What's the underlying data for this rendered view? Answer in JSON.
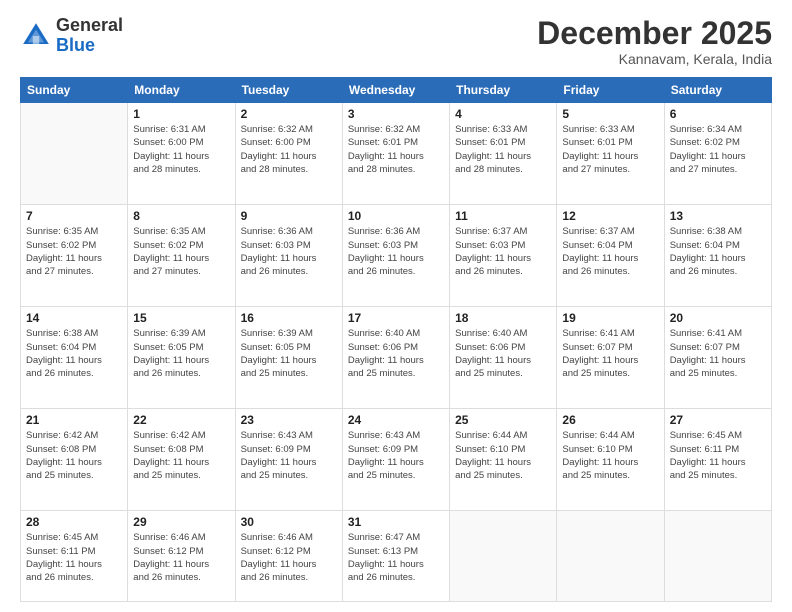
{
  "logo": {
    "general": "General",
    "blue": "Blue"
  },
  "title": "December 2025",
  "location": "Kannavam, Kerala, India",
  "days_of_week": [
    "Sunday",
    "Monday",
    "Tuesday",
    "Wednesday",
    "Thursday",
    "Friday",
    "Saturday"
  ],
  "weeks": [
    [
      {
        "day": "",
        "info": ""
      },
      {
        "day": "1",
        "info": "Sunrise: 6:31 AM\nSunset: 6:00 PM\nDaylight: 11 hours\nand 28 minutes."
      },
      {
        "day": "2",
        "info": "Sunrise: 6:32 AM\nSunset: 6:00 PM\nDaylight: 11 hours\nand 28 minutes."
      },
      {
        "day": "3",
        "info": "Sunrise: 6:32 AM\nSunset: 6:01 PM\nDaylight: 11 hours\nand 28 minutes."
      },
      {
        "day": "4",
        "info": "Sunrise: 6:33 AM\nSunset: 6:01 PM\nDaylight: 11 hours\nand 28 minutes."
      },
      {
        "day": "5",
        "info": "Sunrise: 6:33 AM\nSunset: 6:01 PM\nDaylight: 11 hours\nand 27 minutes."
      },
      {
        "day": "6",
        "info": "Sunrise: 6:34 AM\nSunset: 6:02 PM\nDaylight: 11 hours\nand 27 minutes."
      }
    ],
    [
      {
        "day": "7",
        "info": "Sunrise: 6:35 AM\nSunset: 6:02 PM\nDaylight: 11 hours\nand 27 minutes."
      },
      {
        "day": "8",
        "info": "Sunrise: 6:35 AM\nSunset: 6:02 PM\nDaylight: 11 hours\nand 27 minutes."
      },
      {
        "day": "9",
        "info": "Sunrise: 6:36 AM\nSunset: 6:03 PM\nDaylight: 11 hours\nand 26 minutes."
      },
      {
        "day": "10",
        "info": "Sunrise: 6:36 AM\nSunset: 6:03 PM\nDaylight: 11 hours\nand 26 minutes."
      },
      {
        "day": "11",
        "info": "Sunrise: 6:37 AM\nSunset: 6:03 PM\nDaylight: 11 hours\nand 26 minutes."
      },
      {
        "day": "12",
        "info": "Sunrise: 6:37 AM\nSunset: 6:04 PM\nDaylight: 11 hours\nand 26 minutes."
      },
      {
        "day": "13",
        "info": "Sunrise: 6:38 AM\nSunset: 6:04 PM\nDaylight: 11 hours\nand 26 minutes."
      }
    ],
    [
      {
        "day": "14",
        "info": "Sunrise: 6:38 AM\nSunset: 6:04 PM\nDaylight: 11 hours\nand 26 minutes."
      },
      {
        "day": "15",
        "info": "Sunrise: 6:39 AM\nSunset: 6:05 PM\nDaylight: 11 hours\nand 26 minutes."
      },
      {
        "day": "16",
        "info": "Sunrise: 6:39 AM\nSunset: 6:05 PM\nDaylight: 11 hours\nand 25 minutes."
      },
      {
        "day": "17",
        "info": "Sunrise: 6:40 AM\nSunset: 6:06 PM\nDaylight: 11 hours\nand 25 minutes."
      },
      {
        "day": "18",
        "info": "Sunrise: 6:40 AM\nSunset: 6:06 PM\nDaylight: 11 hours\nand 25 minutes."
      },
      {
        "day": "19",
        "info": "Sunrise: 6:41 AM\nSunset: 6:07 PM\nDaylight: 11 hours\nand 25 minutes."
      },
      {
        "day": "20",
        "info": "Sunrise: 6:41 AM\nSunset: 6:07 PM\nDaylight: 11 hours\nand 25 minutes."
      }
    ],
    [
      {
        "day": "21",
        "info": "Sunrise: 6:42 AM\nSunset: 6:08 PM\nDaylight: 11 hours\nand 25 minutes."
      },
      {
        "day": "22",
        "info": "Sunrise: 6:42 AM\nSunset: 6:08 PM\nDaylight: 11 hours\nand 25 minutes."
      },
      {
        "day": "23",
        "info": "Sunrise: 6:43 AM\nSunset: 6:09 PM\nDaylight: 11 hours\nand 25 minutes."
      },
      {
        "day": "24",
        "info": "Sunrise: 6:43 AM\nSunset: 6:09 PM\nDaylight: 11 hours\nand 25 minutes."
      },
      {
        "day": "25",
        "info": "Sunrise: 6:44 AM\nSunset: 6:10 PM\nDaylight: 11 hours\nand 25 minutes."
      },
      {
        "day": "26",
        "info": "Sunrise: 6:44 AM\nSunset: 6:10 PM\nDaylight: 11 hours\nand 25 minutes."
      },
      {
        "day": "27",
        "info": "Sunrise: 6:45 AM\nSunset: 6:11 PM\nDaylight: 11 hours\nand 25 minutes."
      }
    ],
    [
      {
        "day": "28",
        "info": "Sunrise: 6:45 AM\nSunset: 6:11 PM\nDaylight: 11 hours\nand 26 minutes."
      },
      {
        "day": "29",
        "info": "Sunrise: 6:46 AM\nSunset: 6:12 PM\nDaylight: 11 hours\nand 26 minutes."
      },
      {
        "day": "30",
        "info": "Sunrise: 6:46 AM\nSunset: 6:12 PM\nDaylight: 11 hours\nand 26 minutes."
      },
      {
        "day": "31",
        "info": "Sunrise: 6:47 AM\nSunset: 6:13 PM\nDaylight: 11 hours\nand 26 minutes."
      },
      {
        "day": "",
        "info": ""
      },
      {
        "day": "",
        "info": ""
      },
      {
        "day": "",
        "info": ""
      }
    ]
  ]
}
